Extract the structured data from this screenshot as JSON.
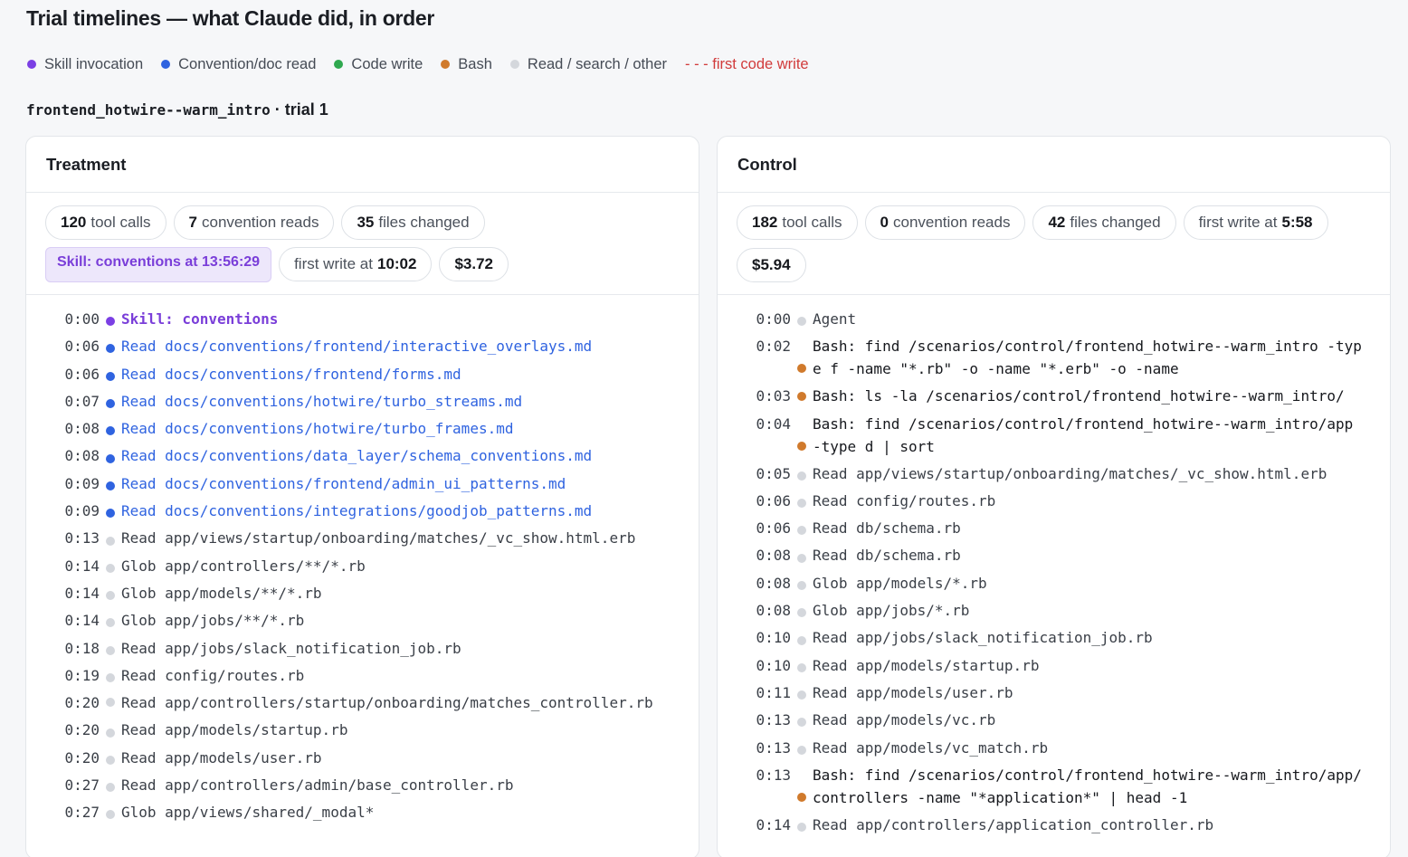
{
  "title": "Trial timelines — what Claude did, in order",
  "legend": [
    {
      "label": "Skill invocation",
      "color": "#7b3fe4",
      "icon": "dot-icon"
    },
    {
      "label": "Convention/doc read",
      "color": "#2f63e0",
      "icon": "dot-icon"
    },
    {
      "label": "Code write",
      "color": "#2fa84f",
      "icon": "dot-icon"
    },
    {
      "label": "Bash",
      "color": "#d07a2c",
      "icon": "dot-icon"
    },
    {
      "label": "Read / search / other",
      "color": "#d4d7dc",
      "icon": "dot-icon"
    }
  ],
  "legend_first_write": "- - - first code write",
  "trial": {
    "scenario": "frontend_hotwire--warm_intro",
    "sep": "·",
    "label": "trial 1"
  },
  "colors": {
    "skill": "#7b3fe4",
    "convention": "#2f63e0",
    "code_write": "#2fa84f",
    "bash": "#d07a2c",
    "other": "#d4d7dc"
  },
  "treatment": {
    "title": "Treatment",
    "stats": {
      "tool_calls": {
        "value": "120",
        "label": "tool calls"
      },
      "convention_reads": {
        "value": "7",
        "label": "convention reads"
      },
      "files_changed": {
        "value": "35",
        "label": "files changed"
      },
      "skill_badge": "Skill: conventions at 13:56:29",
      "first_write": {
        "label": "first write at",
        "value": "10:02"
      },
      "cost": "$3.72"
    },
    "events": [
      {
        "time": "0:00",
        "kind": "skill",
        "text": "Skill: conventions"
      },
      {
        "time": "0:06",
        "kind": "conv",
        "text": "Read docs/conventions/frontend/interactive_overlays.md"
      },
      {
        "time": "0:06",
        "kind": "conv",
        "text": "Read docs/conventions/frontend/forms.md"
      },
      {
        "time": "0:07",
        "kind": "conv",
        "text": "Read docs/conventions/hotwire/turbo_streams.md"
      },
      {
        "time": "0:08",
        "kind": "conv",
        "text": "Read docs/conventions/hotwire/turbo_frames.md"
      },
      {
        "time": "0:08",
        "kind": "conv",
        "text": "Read docs/conventions/data_layer/schema_conventions.md"
      },
      {
        "time": "0:09",
        "kind": "conv",
        "text": "Read docs/conventions/frontend/admin_ui_patterns.md"
      },
      {
        "time": "0:09",
        "kind": "conv",
        "text": "Read docs/conventions/integrations/goodjob_patterns.md"
      },
      {
        "time": "0:13",
        "kind": "other",
        "text": "Read app/views/startup/onboarding/matches/_vc_show.html.erb"
      },
      {
        "time": "0:14",
        "kind": "other",
        "text": "Glob app/controllers/**/*.rb"
      },
      {
        "time": "0:14",
        "kind": "other",
        "text": "Glob app/models/**/*.rb"
      },
      {
        "time": "0:14",
        "kind": "other",
        "text": "Glob app/jobs/**/*.rb"
      },
      {
        "time": "0:18",
        "kind": "other",
        "text": "Read app/jobs/slack_notification_job.rb"
      },
      {
        "time": "0:19",
        "kind": "other",
        "text": "Read config/routes.rb"
      },
      {
        "time": "0:20",
        "kind": "other",
        "text": "Read app/controllers/startup/onboarding/matches_controller.rb",
        "multi": true
      },
      {
        "time": "0:20",
        "kind": "other",
        "text": "Read app/models/startup.rb"
      },
      {
        "time": "0:20",
        "kind": "other",
        "text": "Read app/models/user.rb"
      },
      {
        "time": "0:27",
        "kind": "other",
        "text": "Read app/controllers/admin/base_controller.rb"
      },
      {
        "time": "0:27",
        "kind": "other",
        "text": "Glob app/views/shared/_modal*"
      }
    ]
  },
  "control": {
    "title": "Control",
    "stats": {
      "tool_calls": {
        "value": "182",
        "label": "tool calls"
      },
      "convention_reads": {
        "value": "0",
        "label": "convention reads"
      },
      "files_changed": {
        "value": "42",
        "label": "files changed"
      },
      "first_write": {
        "label": "first write at",
        "value": "5:58"
      },
      "cost": "$5.94"
    },
    "events": [
      {
        "time": "0:00",
        "kind": "other",
        "text": "Agent"
      },
      {
        "time": "0:02",
        "kind": "bash",
        "text": "Bash: find /scenarios/control/frontend_hotwire--warm_intro -type f -name \"*.rb\" -o -name \"*.erb\" -o -name",
        "multi": true
      },
      {
        "time": "0:03",
        "kind": "bash",
        "text": "Bash: ls -la /scenarios/control/frontend_hotwire--warm_intro/",
        "multi": true
      },
      {
        "time": "0:04",
        "kind": "bash",
        "text": "Bash: find /scenarios/control/frontend_hotwire--warm_intro/app -type d | sort",
        "multi": true
      },
      {
        "time": "0:05",
        "kind": "other",
        "text": "Read app/views/startup/onboarding/matches/_vc_show.html.erb"
      },
      {
        "time": "0:06",
        "kind": "other",
        "text": "Read config/routes.rb"
      },
      {
        "time": "0:06",
        "kind": "other",
        "text": "Read db/schema.rb"
      },
      {
        "time": "0:08",
        "kind": "other",
        "text": "Read db/schema.rb"
      },
      {
        "time": "0:08",
        "kind": "other",
        "text": "Glob app/models/*.rb"
      },
      {
        "time": "0:08",
        "kind": "other",
        "text": "Glob app/jobs/*.rb"
      },
      {
        "time": "0:10",
        "kind": "other",
        "text": "Read app/jobs/slack_notification_job.rb"
      },
      {
        "time": "0:10",
        "kind": "other",
        "text": "Read app/models/startup.rb"
      },
      {
        "time": "0:11",
        "kind": "other",
        "text": "Read app/models/user.rb"
      },
      {
        "time": "0:13",
        "kind": "other",
        "text": "Read app/models/vc.rb"
      },
      {
        "time": "0:13",
        "kind": "other",
        "text": "Read app/models/vc_match.rb"
      },
      {
        "time": "0:13",
        "kind": "bash",
        "text": "Bash: find /scenarios/control/frontend_hotwire--warm_intro/app/controllers -name \"*application*\" | head -1",
        "multi": true
      },
      {
        "time": "0:14",
        "kind": "other",
        "text": "Read app/controllers/application_controller.rb"
      }
    ]
  }
}
